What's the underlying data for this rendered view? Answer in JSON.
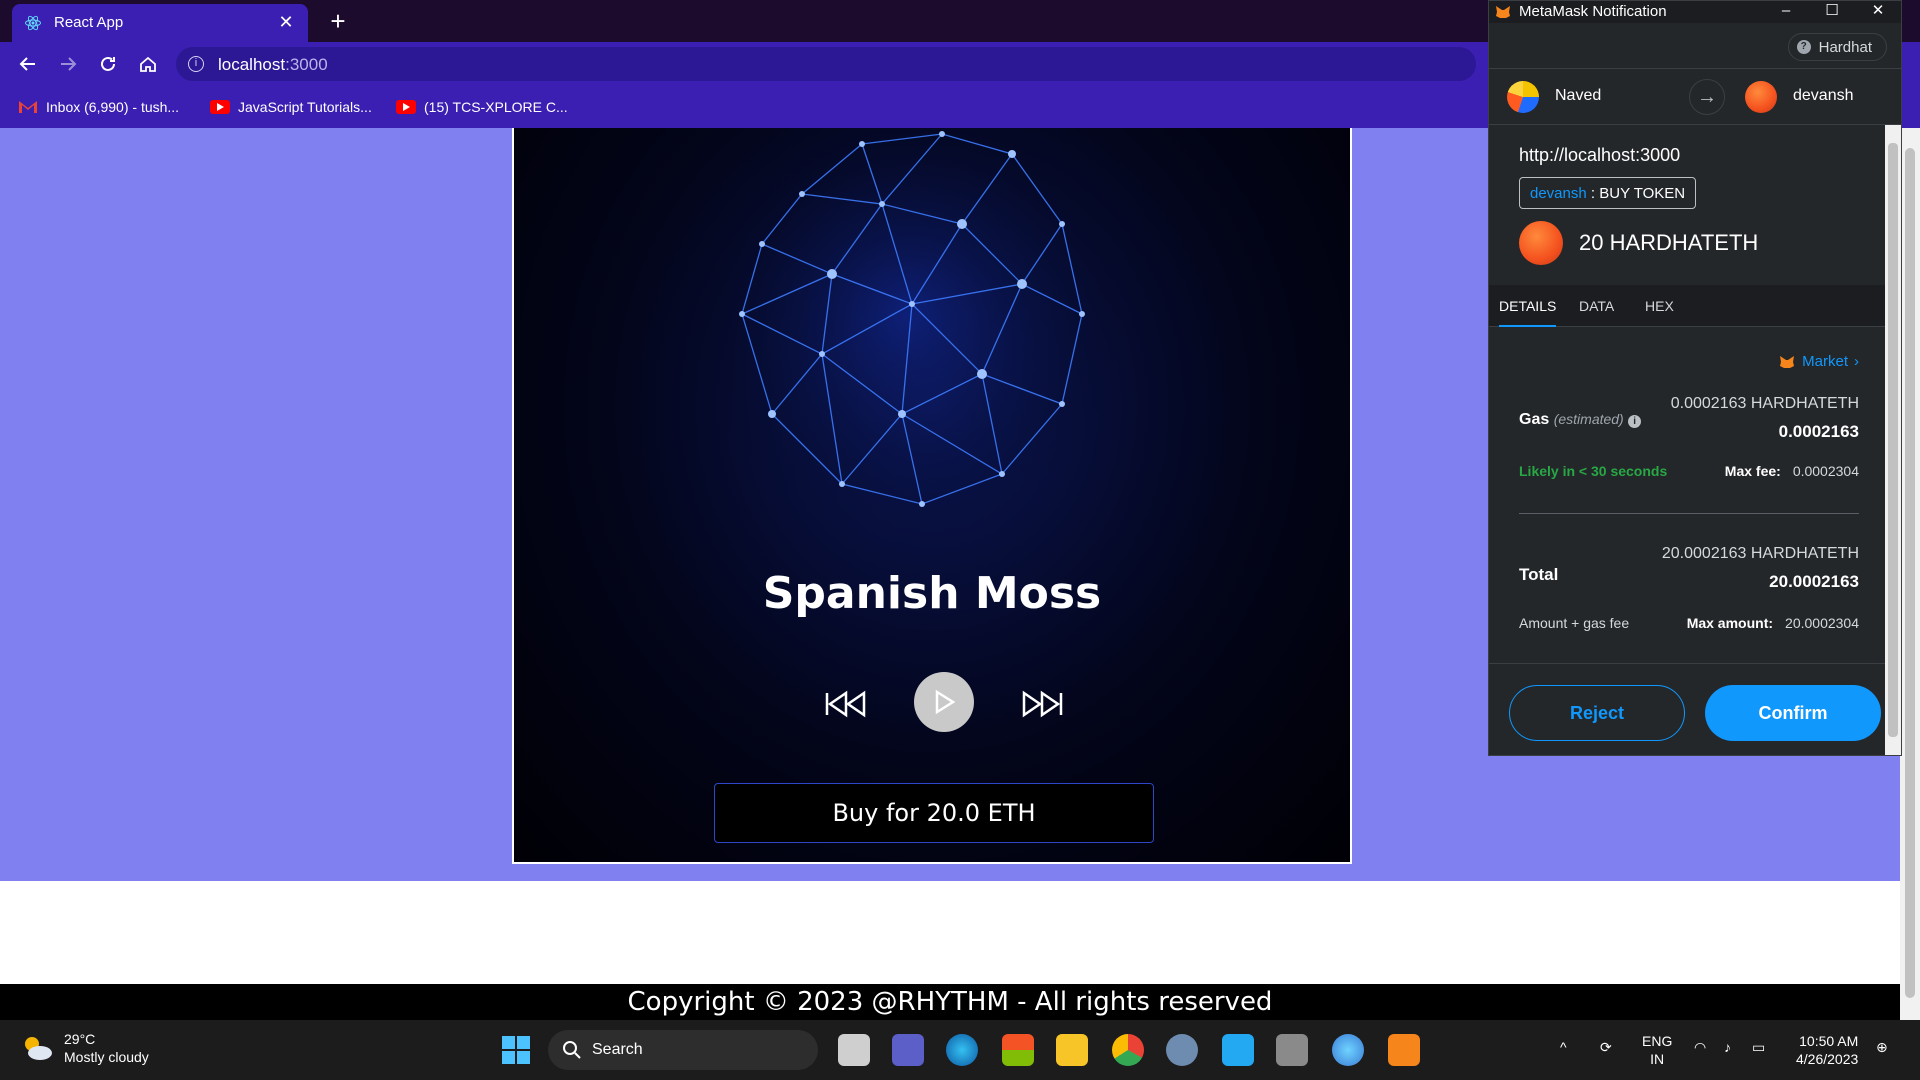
{
  "browser": {
    "tab_title": "React App",
    "url_host": "localhost",
    "url_port": ":3000",
    "bookmarks": [
      {
        "label": "Inbox (6,990) - tush..."
      },
      {
        "label": "JavaScript Tutorials..."
      },
      {
        "label": "(15) TCS-XPLORE C..."
      }
    ]
  },
  "player": {
    "song_title": "Spanish Moss",
    "buy_label": "Buy for 20.0 ETH"
  },
  "footer": {
    "copyright": "Copyright © 2023 @RHYTHM - All rights reserved"
  },
  "metamask": {
    "window_title": "MetaMask Notification",
    "network": "Hardhat",
    "from_account": "Naved",
    "to_account": "devansh",
    "origin": "http://localhost:3000",
    "method_contract": "devansh",
    "method_sep": " : ",
    "method_name": "BUY TOKEN",
    "amount": "20 HARDHATETH",
    "tabs": [
      "DETAILS",
      "DATA",
      "HEX"
    ],
    "active_tab": "DETAILS",
    "market_label": "Market",
    "gas_label": "Gas",
    "gas_estimated": "(estimated)",
    "gas_value_full": "0.0002163 HARDHATETH",
    "gas_value_short": "0.0002163",
    "likely": "Likely in < 30 seconds",
    "max_fee_label": "Max fee:",
    "max_fee_value": "0.0002304",
    "total_label": "Total",
    "total_full": "20.0002163 HARDHATETH",
    "total_short": "20.0002163",
    "amount_gas_label": "Amount + gas fee",
    "max_amount_label": "Max amount:",
    "max_amount_value": "20.0002304",
    "reject_label": "Reject",
    "confirm_label": "Confirm",
    "colors": {
      "accent": "#1098fc",
      "success": "#28a745",
      "bg": "#24272a"
    }
  },
  "taskbar": {
    "temperature": "29°C",
    "weather": "Mostly cloudy",
    "search_label": "Search",
    "lang_top": "ENG",
    "lang_bottom": "IN",
    "time": "10:50 AM",
    "date": "4/26/2023"
  }
}
